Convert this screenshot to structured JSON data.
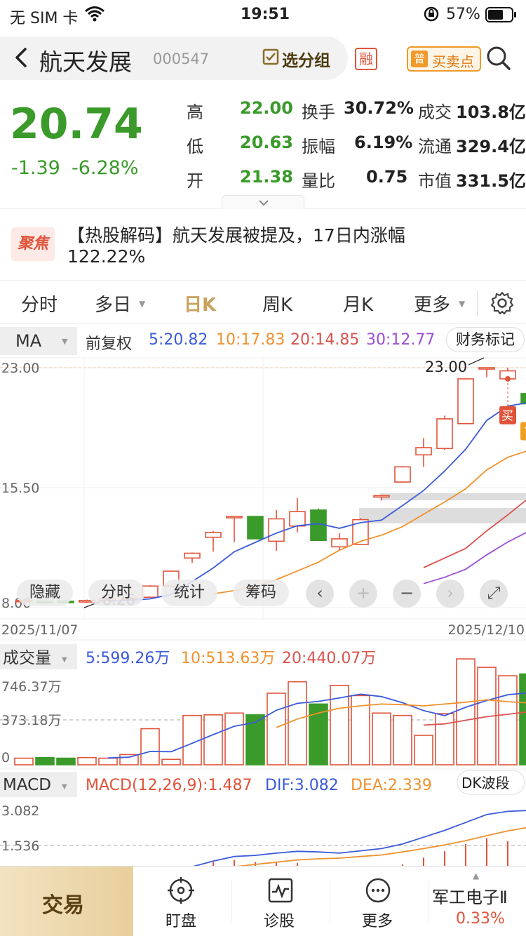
{
  "status_bar": {
    "carrier": "无 SIM 卡",
    "time": "19:51",
    "battery": "57%"
  },
  "header": {
    "stock_name": "航天发展",
    "stock_code": "000547",
    "group_button": "选分组",
    "rong_badge": "融",
    "buy_sell_button": "买卖点",
    "buy_sell_badge": "普"
  },
  "quote": {
    "price": "20.74",
    "change": "-1.39",
    "change_pct": "-6.28%",
    "rows": [
      [
        {
          "label": "高",
          "value": "22.00"
        },
        {
          "label": "换手",
          "value": "30.72%"
        },
        {
          "label": "成交",
          "value": "103.8亿"
        }
      ],
      [
        {
          "label": "低",
          "value": "20.63"
        },
        {
          "label": "振幅",
          "value": "6.19%"
        },
        {
          "label": "流通",
          "value": "329.4亿"
        }
      ],
      [
        {
          "label": "开",
          "value": "21.38"
        },
        {
          "label": "量比",
          "value": "0.75"
        },
        {
          "label": "市值",
          "value": "331.5亿"
        }
      ]
    ]
  },
  "news": {
    "badge": "聚焦",
    "line1": "【热股解码】航天发展被提及，17日内涨幅",
    "line2": "122.22%"
  },
  "tabs": [
    "分时",
    "多日",
    "日K",
    "周K",
    "月K",
    "更多"
  ],
  "active_tab": "日K",
  "ma_bar": {
    "indicator": "MA",
    "adjust": "前复权",
    "ma5": "5:20.82",
    "ma10": "10:17.83",
    "ma20": "20:14.85",
    "ma30": "30:12.77",
    "fin_button": "财务标记"
  },
  "colors": {
    "up": "#e0533a",
    "down": "#3a9a2a",
    "ma5": "#3b5bdb",
    "ma10": "#f0912e",
    "ma20": "#d9534f",
    "ma30": "#9b4fd9",
    "gold": "#c9a25f"
  },
  "chart_data": [
    {
      "type": "candlestick",
      "title": "日K",
      "x_start_label": "2025/11/07",
      "x_end_label": "2025/12/10",
      "ylim": [
        8.0,
        23.0
      ],
      "ytick_labels": [
        "23.00",
        "15.50",
        "8.00"
      ],
      "high_annotation": "23.00",
      "low_annotation": "8.26",
      "candles": [
        {
          "o": 8.4,
          "c": 8.45,
          "h": 8.5,
          "l": 8.35
        },
        {
          "o": 8.4,
          "c": 8.3,
          "h": 8.45,
          "l": 8.26
        },
        {
          "o": 8.4,
          "c": 8.35,
          "h": 8.45,
          "l": 8.3
        },
        {
          "o": 8.35,
          "c": 8.45,
          "h": 8.5,
          "l": 8.3
        },
        {
          "o": 8.45,
          "c": 8.55,
          "h": 8.6,
          "l": 8.4
        },
        {
          "o": 8.55,
          "c": 8.6,
          "h": 8.65,
          "l": 8.5
        },
        {
          "o": 8.65,
          "c": 9.35,
          "h": 9.4,
          "l": 8.65
        },
        {
          "o": 9.35,
          "c": 10.28,
          "h": 10.3,
          "l": 9.35
        },
        {
          "o": 11.1,
          "c": 11.4,
          "h": 11.45,
          "l": 10.8
        },
        {
          "o": 12.4,
          "c": 12.7,
          "h": 12.8,
          "l": 11.5
        },
        {
          "o": 13.62,
          "c": 13.7,
          "h": 13.7,
          "l": 12.1
        },
        {
          "o": 13.7,
          "c": 12.3,
          "h": 13.7,
          "l": 12.3
        },
        {
          "o": 12.15,
          "c": 13.55,
          "h": 14.1,
          "l": 11.55
        },
        {
          "o": 13.1,
          "c": 14.0,
          "h": 14.85,
          "l": 12.7
        },
        {
          "o": 14.1,
          "c": 12.2,
          "h": 14.2,
          "l": 12.2
        },
        {
          "o": 11.8,
          "c": 12.3,
          "h": 12.65,
          "l": 11.55
        },
        {
          "o": 11.95,
          "c": 13.5,
          "h": 13.6,
          "l": 11.95
        },
        {
          "o": 15.0,
          "c": 15.0,
          "h": 15.05,
          "l": 14.7
        },
        {
          "o": 15.85,
          "c": 16.8,
          "h": 16.85,
          "l": 15.85
        },
        {
          "o": 17.55,
          "c": 18.0,
          "h": 18.6,
          "l": 16.8
        },
        {
          "o": 17.95,
          "c": 19.8,
          "h": 20.0,
          "l": 17.85
        },
        {
          "o": 19.5,
          "c": 22.3,
          "h": 22.35,
          "l": 19.5
        },
        {
          "o": 23.0,
          "c": 23.0,
          "h": 23.0,
          "l": 22.4
        },
        {
          "o": 22.3,
          "c": 22.8,
          "h": 23.0,
          "l": 22.2
        },
        {
          "o": 21.38,
          "c": 20.74,
          "h": 22.0,
          "l": 20.63
        }
      ],
      "ma5": [
        null,
        null,
        null,
        null,
        8.4,
        8.45,
        8.55,
        8.82,
        9.63,
        10.48,
        11.49,
        12.08,
        12.66,
        13.12,
        13.25,
        12.96,
        13.31,
        13.47,
        14.38,
        15.32,
        16.54,
        17.9,
        19.7,
        20.6,
        20.82
      ],
      "ma10": [
        null,
        null,
        null,
        null,
        null,
        null,
        null,
        null,
        null,
        8.86,
        9.06,
        9.33,
        9.75,
        10.29,
        10.84,
        11.59,
        12.14,
        12.53,
        13.06,
        13.84,
        14.6,
        15.43,
        16.61,
        17.4,
        17.83
      ],
      "ma20": [
        null,
        null,
        null,
        null,
        null,
        null,
        null,
        null,
        null,
        null,
        null,
        null,
        null,
        null,
        null,
        null,
        null,
        null,
        null,
        10.5,
        11.1,
        11.7,
        12.8,
        13.8,
        14.85
      ],
      "ma30": [
        null,
        null,
        null,
        null,
        null,
        null,
        null,
        null,
        null,
        null,
        null,
        null,
        null,
        null,
        null,
        null,
        null,
        null,
        null,
        9.5,
        9.9,
        10.4,
        11.3,
        12.1,
        12.77
      ],
      "buy_label": "买",
      "t_label": "T"
    },
    {
      "type": "bar",
      "title": "成交量",
      "unit": "万",
      "ma5_label": "5:599.26万",
      "ma10_label": "10:513.63万",
      "ma20_label": "20:440.07万",
      "ytick_labels": [
        "746.37万",
        "373.18万",
        "0"
      ],
      "ylim": [
        0,
        746.37
      ],
      "values": [
        55,
        60,
        55,
        60,
        55,
        85,
        300,
        45,
        410,
        415,
        430,
        415,
        595,
        690,
        505,
        660,
        575,
        430,
        410,
        245,
        425,
        880,
        810,
        740,
        755
      ],
      "ma5": [
        null,
        null,
        null,
        null,
        57,
        63,
        111,
        109,
        179,
        251,
        320,
        353,
        453,
        511,
        527,
        555,
        587,
        567,
        516,
        450,
        409,
        478,
        534,
        582,
        599
      ],
      "ma10": [
        null,
        null,
        null,
        null,
        null,
        null,
        null,
        null,
        null,
        null,
        null,
        null,
        310,
        380,
        430,
        470,
        490,
        505,
        500,
        490,
        505,
        520,
        540,
        525,
        514
      ],
      "ma20": [
        null,
        null,
        null,
        null,
        null,
        null,
        null,
        null,
        null,
        null,
        null,
        null,
        null,
        null,
        null,
        null,
        null,
        null,
        null,
        330,
        340,
        370,
        400,
        420,
        440
      ]
    },
    {
      "type": "line",
      "title": "MACD",
      "params": "MACD(12,26,9):1.487",
      "dif_label": "DIF:3.082",
      "dea_label": "DEA:2.339",
      "ytick_labels": [
        "3.082",
        "1.536"
      ],
      "dk_button": "DK波段",
      "dif": [
        null,
        null,
        null,
        null,
        null,
        null,
        null,
        null,
        0.6,
        0.85,
        1.05,
        1.1,
        1.2,
        1.28,
        1.25,
        1.2,
        1.3,
        1.4,
        1.6,
        1.9,
        2.2,
        2.55,
        2.9,
        3.04,
        3.082
      ],
      "dea": [
        null,
        null,
        null,
        null,
        null,
        null,
        null,
        null,
        0.3,
        0.45,
        0.6,
        0.7,
        0.8,
        0.9,
        0.95,
        0.98,
        1.05,
        1.12,
        1.25,
        1.4,
        1.56,
        1.75,
        1.97,
        2.18,
        2.339
      ]
    }
  ],
  "chart_controls": [
    "隐藏",
    "分时",
    "统计",
    "筹码"
  ],
  "footer": {
    "trade": "交易",
    "items": [
      "盯盘",
      "诊股",
      "更多"
    ],
    "sector_name": "军工电子Ⅱ",
    "sector_pct": "0.33%"
  }
}
